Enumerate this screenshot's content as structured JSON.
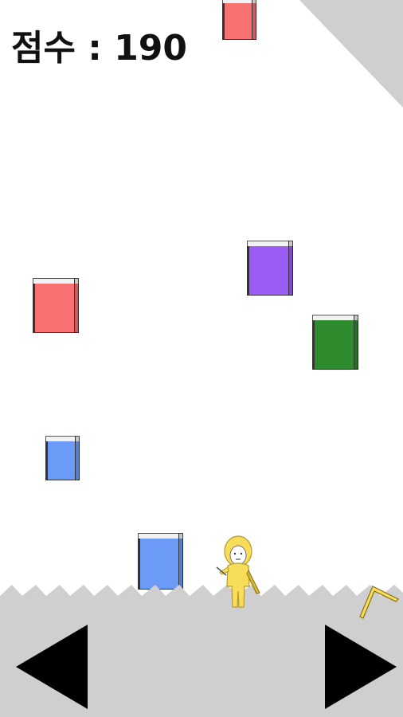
{
  "hud": {
    "score_text": "점수 : 190"
  },
  "colors": {
    "background": "#ffffff",
    "ground": "#cfcfcf",
    "red_book": "#f87171",
    "purple_book": "#9b5cf6",
    "green_book": "#2e8b2e",
    "blue_book": "#6b9bf7",
    "player": "#f7dd5a"
  },
  "books": [
    {
      "name": "red-book-top",
      "color": "red"
    },
    {
      "name": "red-book-left",
      "color": "red"
    },
    {
      "name": "purple-book",
      "color": "purple"
    },
    {
      "name": "green-book",
      "color": "green"
    },
    {
      "name": "blue-book-small",
      "color": "blue"
    },
    {
      "name": "blue-book-ground",
      "color": "blue"
    }
  ],
  "controls": {
    "left_icon": "left-arrow-icon",
    "right_icon": "right-arrow-icon"
  }
}
